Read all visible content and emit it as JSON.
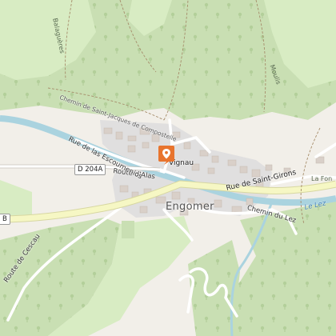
{
  "map": {
    "town": "Engomer",
    "hamlet": "Vignau",
    "roads": {
      "rue_saint_girons": "Rue de Saint-Girons",
      "route_alas": "Route d'Alas",
      "rue_escoumenios": "Rue de las Escoumenios",
      "chemin_lez": "Chemin du Lez",
      "route_cescau": "Route de Cescau",
      "chemin_compostelle": "Chemin de Saint-Jacques de Compostelle"
    },
    "shields": {
      "d204a": "D 204A",
      "left_edge": "B"
    },
    "water": "Le Lez",
    "places": {
      "la_fon": "La Fon",
      "balagueres": "Balaguères",
      "moulis": "Moulis"
    },
    "marker": {
      "icon": "map-pin-icon",
      "color": "#e8742e"
    },
    "colors": {
      "forest": "#c9dfb3",
      "meadow": "#d8ecc3",
      "farmland": "#f2efe9",
      "river": "#aad3df",
      "main_road": "#f6f7c4",
      "residential": "#e0dfdf",
      "building": "#d9d0c9"
    }
  }
}
